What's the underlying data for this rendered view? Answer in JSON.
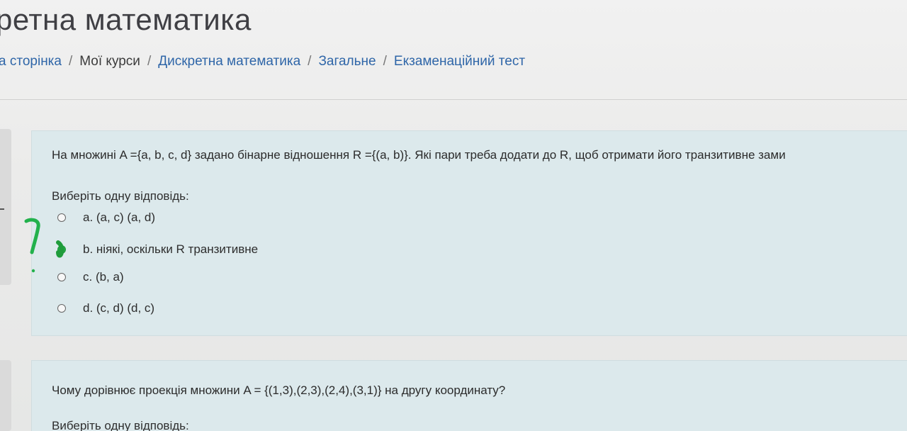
{
  "header": {
    "course_title": "ретна математика"
  },
  "breadcrumb": {
    "items": [
      {
        "label": "а сторінка"
      },
      {
        "label": "Мої курси"
      },
      {
        "label": "Дискретна математика"
      },
      {
        "label": "Загальне"
      },
      {
        "label": "Екзаменаційний тест"
      }
    ],
    "separator": "/"
  },
  "questions": [
    {
      "text": "На множині A ={a, b, c, d} задано бінарне відношення R ={(a, b)}. Які пари треба додати до R, щоб отримати його транзитивне зами",
      "prompt": "Виберіть одну відповідь:",
      "answers": [
        {
          "label": "a. (a, c) (a, d)",
          "selected": false
        },
        {
          "label": "b. ніякі, оскільки R транзитивне",
          "selected": true
        },
        {
          "label": "c. (b, a)",
          "selected": false
        },
        {
          "label": "d. (c, d) (d, c)",
          "selected": false
        }
      ]
    },
    {
      "text": "Чому дорівнює проекція множини A = {(1,3),(2,3),(2,4),(3,1)} на другу координату?",
      "prompt": "Виберіть одну відповідь:"
    }
  ],
  "annotation": {
    "mark": "?",
    "color": "#22b14c"
  }
}
